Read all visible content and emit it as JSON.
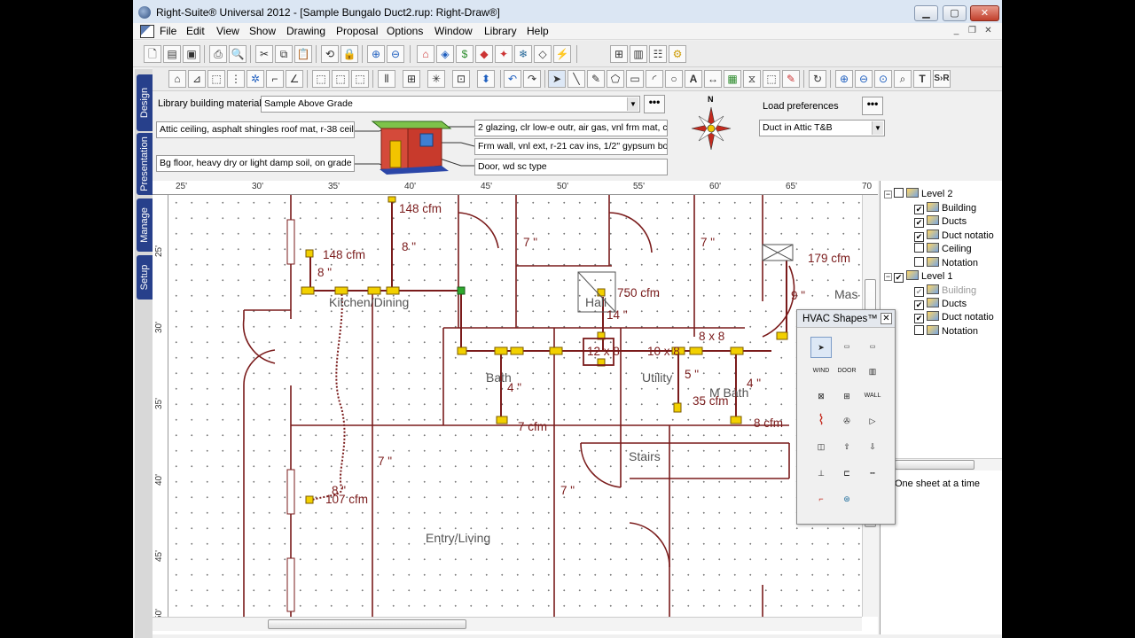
{
  "window": {
    "title": "Right-Suite® Universal 2012 - [Sample Bungalo Duct2.rup: Right-Draw®]",
    "min": "▁",
    "max": "▢",
    "close": "✕"
  },
  "menu": [
    "File",
    "Edit",
    "View",
    "Show",
    "Drawing",
    "Proposal",
    "Options",
    "Window",
    "Library",
    "Help"
  ],
  "side_tabs": [
    "Design",
    "Presentation",
    "Manage",
    "Setup"
  ],
  "materials": {
    "library_label": "Library building materials",
    "library_value": "Sample Above Grade",
    "attic": "Attic ceiling, asphalt shingles roof mat, r-38 ceil ir",
    "floor": "Bg floor, heavy dry or light damp soil, on grade d",
    "glazing": "2 glazing, clr low-e outr, air gas, vnl frm mat, clr",
    "wall": "Frm wall, vnl ext, r-21 cav ins, 1/2\" gypsum boa",
    "door": "Door, wd sc type",
    "load_label": "Load preferences",
    "load_value": "Duct in Attic T&B",
    "more": "•••",
    "compass_n": "N"
  },
  "ruler": {
    "h_ticks": [
      "25'",
      "30'",
      "35'",
      "40'",
      "45'",
      "50'",
      "55'",
      "60'",
      "65'",
      "70"
    ],
    "v_ticks": [
      "25'",
      "30'",
      "35'",
      "40'",
      "45'",
      "50'"
    ]
  },
  "plan": {
    "rooms": [
      "Kitchen/Dining",
      "Hall",
      "Bath",
      "Utility",
      "M Bath",
      "Stairs",
      "Entry/Living",
      "Mas"
    ],
    "cfm": [
      "148 cfm",
      "148 cfm",
      "179 cfm",
      "750 cfm",
      "35 cfm",
      "7 cfm",
      "8 cfm",
      "107 cfm"
    ],
    "sizes": [
      "8 \"",
      "8 \"",
      "7 \"",
      "7 \"",
      "9 \"",
      "14 \"",
      "12 x 8",
      "10 x 8",
      "8 x 8",
      "4 \"",
      "5 \"",
      "4 \"",
      "7 \"",
      "7 \"",
      "8 \""
    ]
  },
  "hvac": {
    "title": "HVAC Shapes™",
    "close": "✕",
    "tools": [
      "pointer",
      "FOOM",
      "FOOM",
      "WIND",
      "DOOR",
      "grille",
      "room",
      "window",
      "WALL",
      "coil",
      "fan",
      "damper",
      "duct",
      "up",
      "down",
      "boot",
      "tee",
      "ruler",
      "flex",
      "diffuser"
    ]
  },
  "tree": {
    "level2": "Level 2",
    "level1": "Level 1",
    "level2_items": [
      {
        "label": "Building",
        "checked": true
      },
      {
        "label": "Ducts",
        "checked": true
      },
      {
        "label": "Duct notatio",
        "checked": true
      },
      {
        "label": "Ceiling",
        "checked": false
      },
      {
        "label": "Notation",
        "checked": false
      }
    ],
    "level1_items": [
      {
        "label": "Building",
        "checked": true
      },
      {
        "label": "Ducts",
        "checked": true
      },
      {
        "label": "Duct notatio",
        "checked": true
      },
      {
        "label": "Notation",
        "checked": false
      }
    ],
    "sheet_label": "One sheet at a time"
  },
  "colors": {
    "duct": "#7a1b1b",
    "fitting": "#f2d000",
    "tab": "#27408b"
  }
}
